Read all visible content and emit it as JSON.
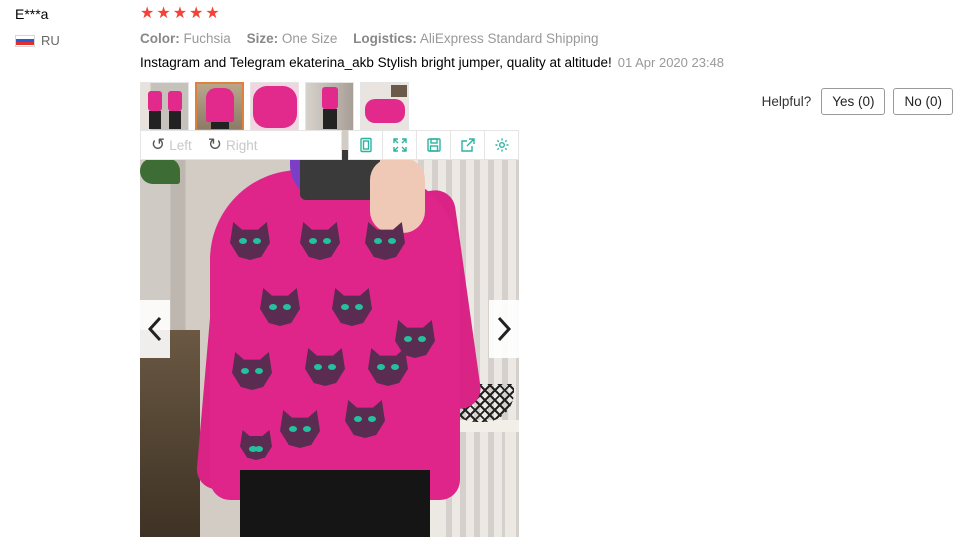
{
  "review": {
    "user": {
      "name": "E***a",
      "country": "RU"
    },
    "rating": 5,
    "stars": [
      "★",
      "★",
      "★",
      "★",
      "★"
    ],
    "attributes": [
      {
        "key": "Color:",
        "value": "Fuchsia"
      },
      {
        "key": "Size:",
        "value": "One Size"
      },
      {
        "key": "Logistics:",
        "value": "AliExpress Standard Shipping"
      }
    ],
    "comment": "Instagram and Telegram ekaterina_akb Stylish bright jumper, quality at altitude!",
    "date": "01 Apr 2020 23:48"
  },
  "helpful": {
    "label": "Helpful?",
    "yes": "Yes (0)",
    "no": "No (0)"
  },
  "thumbnails": [
    {
      "id": "thumb-1",
      "active": false
    },
    {
      "id": "thumb-2",
      "active": true
    },
    {
      "id": "thumb-3",
      "active": false
    },
    {
      "id": "thumb-4",
      "active": false
    },
    {
      "id": "thumb-5",
      "active": false
    }
  ],
  "viewer": {
    "rotate_left": "Left",
    "rotate_right": "Right",
    "tools": [
      "fit-icon",
      "fullscreen-icon",
      "save-icon",
      "share-icon",
      "settings-icon"
    ]
  },
  "colors": {
    "star": "#f44336",
    "accent": "#e0803a",
    "toolbar_icon": "#2bb3a0",
    "sweater": "#e0258a"
  }
}
